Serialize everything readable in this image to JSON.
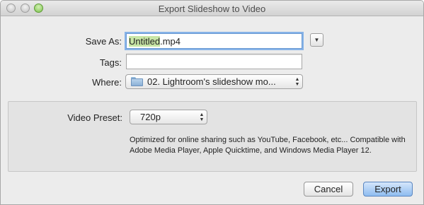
{
  "window": {
    "title": "Export Slideshow to Video"
  },
  "form": {
    "save_as": {
      "label": "Save As:",
      "value_selected": "Untitled",
      "value_rest": ".mp4"
    },
    "tags": {
      "label": "Tags:",
      "value": ""
    },
    "where": {
      "label": "Where:",
      "value": "02. Lightroom's slideshow mo...",
      "icon": "folder-icon"
    }
  },
  "video": {
    "preset_label": "Video Preset:",
    "preset_value": "720p",
    "description": "Optimized for online sharing such as YouTube, Facebook, etc... Compatible with Adobe Media Player, Apple Quicktime, and Windows Media Player 12."
  },
  "buttons": {
    "cancel": "Cancel",
    "export": "Export"
  },
  "colors": {
    "selection": "#c8e6a6",
    "focus_ring": "#86b3e8",
    "default_button": "#8ebcf0"
  }
}
